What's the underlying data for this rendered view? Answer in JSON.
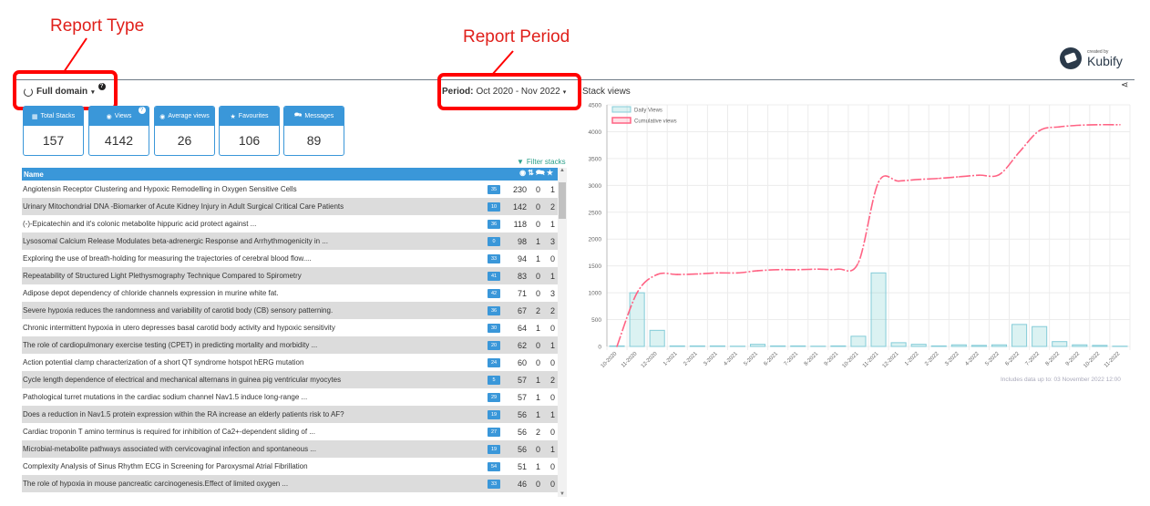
{
  "annotations": {
    "report_type": "Report Type",
    "report_period": "Report Period"
  },
  "brand": {
    "created_by": "created by",
    "name": "Kubify"
  },
  "report_type": {
    "label": "Full domain",
    "help": "?"
  },
  "period": {
    "label": "Period:",
    "value": "Oct 2020 - Nov 2022"
  },
  "stats": [
    {
      "label": "Total Stacks",
      "value": "157",
      "icon": "grid-icon"
    },
    {
      "label": "Views",
      "value": "4142",
      "icon": "eye-icon"
    },
    {
      "label": "Average views",
      "value": "26",
      "icon": "eye-icon"
    },
    {
      "label": "Favourites",
      "value": "106",
      "icon": "star-icon"
    },
    {
      "label": "Messages",
      "value": "89",
      "icon": "comments-icon"
    }
  ],
  "filter_label": "Filter stacks",
  "table": {
    "name_header": "Name",
    "rows": [
      {
        "name": "Angiotensin Receptor Clustering and Hypoxic Remodelling in Oxygen Sensitive Cells",
        "badge": "35",
        "views": "230",
        "messages": "0",
        "favs": "1"
      },
      {
        "name": "Urinary Mitochondrial DNA -Biomarker of Acute Kidney Injury in Adult Surgical Critical Care Patients",
        "badge": "10",
        "views": "142",
        "messages": "0",
        "favs": "2"
      },
      {
        "name": "(-)-Epicatechin and it's colonic metabolite hippuric acid protect against ...",
        "badge": "36",
        "views": "118",
        "messages": "0",
        "favs": "1"
      },
      {
        "name": "Lysosomal Calcium Release Modulates beta-adrenergic Response and Arrhythmogenicity in ...",
        "badge": "0",
        "views": "98",
        "messages": "1",
        "favs": "3"
      },
      {
        "name": "Exploring the use of breath-holding for measuring the trajectories of cerebral blood flow....",
        "badge": "33",
        "views": "94",
        "messages": "1",
        "favs": "0"
      },
      {
        "name": "Repeatability of Structured Light Plethysmography Technique Compared to Spirometry",
        "badge": "41",
        "views": "83",
        "messages": "0",
        "favs": "1"
      },
      {
        "name": "Adipose depot dependency of chloride channels expression in murine white fat.",
        "badge": "42",
        "views": "71",
        "messages": "0",
        "favs": "3"
      },
      {
        "name": "Severe hypoxia reduces the randomness and variability of carotid body (CB) sensory patterning.",
        "badge": "36",
        "views": "67",
        "messages": "2",
        "favs": "2"
      },
      {
        "name": "Chronic intermittent hypoxia in utero depresses basal carotid body activity and hypoxic sensitivity",
        "badge": "30",
        "views": "64",
        "messages": "1",
        "favs": "0"
      },
      {
        "name": "The role of cardiopulmonary exercise testing (CPET) in predicting mortality and morbidity ...",
        "badge": "20",
        "views": "62",
        "messages": "0",
        "favs": "1"
      },
      {
        "name": "Action potential clamp characterization of a short QT syndrome hotspot hERG mutation",
        "badge": "24",
        "views": "60",
        "messages": "0",
        "favs": "0"
      },
      {
        "name": "Cycle length dependence of electrical and mechanical alternans in guinea pig ventricular myocytes",
        "badge": "5",
        "views": "57",
        "messages": "1",
        "favs": "2"
      },
      {
        "name": "Pathological turret mutations in the cardiac sodium channel Nav1.5 induce long-range ...",
        "badge": "29",
        "views": "57",
        "messages": "1",
        "favs": "0"
      },
      {
        "name": "Does a reduction in Nav1.5 protein expression within the RA increase an elderly patients risk to AF?",
        "badge": "19",
        "views": "56",
        "messages": "1",
        "favs": "1"
      },
      {
        "name": "Cardiac troponin T amino terminus is required for inhibition of Ca2+-dependent sliding of ...",
        "badge": "27",
        "views": "56",
        "messages": "2",
        "favs": "0"
      },
      {
        "name": "Microbial-metabolite pathways associated with cervicovaginal infection and spontaneous ...",
        "badge": "19",
        "views": "56",
        "messages": "0",
        "favs": "1"
      },
      {
        "name": "Complexity Analysis of Sinus Rhythm ECG in Screening for Paroxysmal Atrial Fibrillation",
        "badge": "54",
        "views": "51",
        "messages": "1",
        "favs": "0"
      },
      {
        "name": "The role of hypoxia in mouse pancreatic carcinogenesis.Effect of limited oxygen ...",
        "badge": "33",
        "views": "46",
        "messages": "0",
        "favs": "0"
      }
    ]
  },
  "chart_data": {
    "type": "bar",
    "title": "Stack views",
    "footnote": "Includes data up to: 03 November 2022 12:00",
    "categories": [
      "10-2020",
      "11-2020",
      "12-2020",
      "1-2021",
      "2-2021",
      "3-2021",
      "4-2021",
      "5-2021",
      "6-2021",
      "7-2021",
      "8-2021",
      "9-2021",
      "10-2021",
      "11-2021",
      "12-2021",
      "1-2022",
      "2-2022",
      "3-2022",
      "4-2022",
      "5-2022",
      "6-2022",
      "7-2022",
      "8-2022",
      "9-2022",
      "10-2022",
      "11-2022"
    ],
    "ylim": [
      0,
      4500
    ],
    "yticks": [
      0,
      500,
      1000,
      1500,
      2000,
      2500,
      3000,
      3500,
      4000,
      4500
    ],
    "grid": true,
    "legend": "top-left",
    "series": [
      {
        "name": "Daily Views",
        "type": "bar",
        "color": "#4bc0c0",
        "values": [
          10,
          1000,
          300,
          10,
          10,
          10,
          5,
          40,
          10,
          10,
          5,
          10,
          190,
          1370,
          70,
          40,
          10,
          30,
          20,
          30,
          410,
          370,
          90,
          30,
          20,
          5
        ]
      },
      {
        "name": "Cumulative views",
        "type": "line",
        "color": "#ff6384",
        "values": [
          0,
          1000,
          1340,
          1340,
          1350,
          1370,
          1370,
          1410,
          1430,
          1430,
          1440,
          1440,
          1560,
          3060,
          3080,
          3110,
          3130,
          3160,
          3190,
          3200,
          3620,
          4020,
          4090,
          4120,
          4130,
          4130
        ]
      }
    ]
  }
}
